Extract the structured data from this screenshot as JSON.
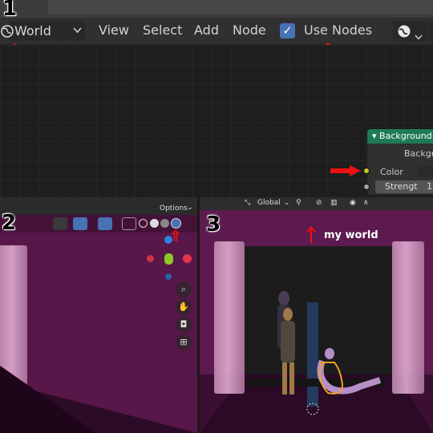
{
  "badges": {
    "one": "1",
    "two": "2",
    "three": "3"
  },
  "node_editor": {
    "world_dropdown": "World",
    "menus": [
      "View",
      "Select",
      "Add",
      "Node"
    ],
    "use_nodes_label": "Use Nodes",
    "use_nodes_checked": true,
    "check_glyph": "✓",
    "chevron_glyph": "⌄"
  },
  "node": {
    "title": "Background",
    "output_label": "Backgr",
    "color_label": "Color",
    "strength_label": "Strengt",
    "strength_value": "1."
  },
  "viewport2": {
    "options_label": "Options",
    "nav_icons": [
      "zoom-icon",
      "hand-pan-icon",
      "camera-icon",
      "grid-view-icon"
    ]
  },
  "viewport3": {
    "transform_orientation": "Global",
    "annotation": "my world"
  },
  "colors": {
    "accent": "#4772b3",
    "node_header": "#1f7a56",
    "world_bg": "#5c1a4e",
    "annotation_red": "#e11111"
  }
}
